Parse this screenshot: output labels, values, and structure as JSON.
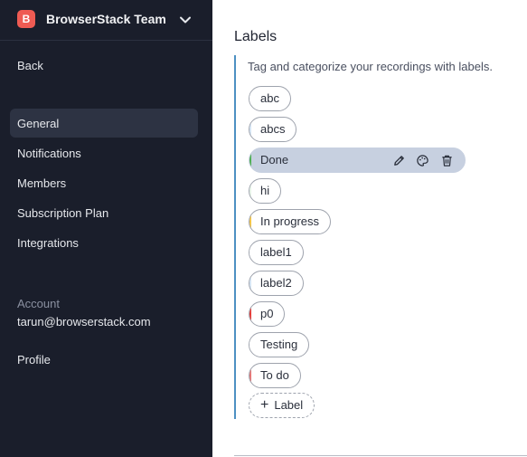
{
  "sidebar": {
    "team_initial": "B",
    "team_name": "BrowserStack Team",
    "back_label": "Back",
    "nav": [
      "General",
      "Notifications",
      "Members",
      "Subscription Plan",
      "Integrations"
    ],
    "account_heading": "Account",
    "account_email": "tarun@browserstack.com",
    "profile_label": "Profile"
  },
  "content": {
    "title": "Labels",
    "description": "Tag and categorize your recordings with labels.",
    "labels": [
      {
        "name": "abc",
        "color": "#ffffff"
      },
      {
        "name": "abcs",
        "color": "#d6e6f5"
      },
      {
        "name": "Done",
        "color": "#4caf50"
      },
      {
        "name": "hi",
        "color": "#e8f5e9"
      },
      {
        "name": "In progress",
        "color": "#f5c542"
      },
      {
        "name": "label1",
        "color": "#ffffff"
      },
      {
        "name": "label2",
        "color": "#d6e6f5"
      },
      {
        "name": "p0",
        "color": "#e53935"
      },
      {
        "name": "Testing",
        "color": "#ffffff"
      },
      {
        "name": "To do",
        "color": "#e57373"
      }
    ],
    "add_label": "Label"
  },
  "colors": {
    "sidebar_bg": "#1a1e2b",
    "active_nav_bg": "#2d3343",
    "team_avatar": "#ef5b53",
    "panel_accent": "#4d90c2",
    "hovered_chip_bg": "#c7d0e0"
  },
  "icons": {
    "team_dropdown": "chevron-down-icon",
    "edit": "pencil-icon",
    "color": "palette-icon",
    "delete": "trash-icon",
    "add": "plus-icon"
  }
}
